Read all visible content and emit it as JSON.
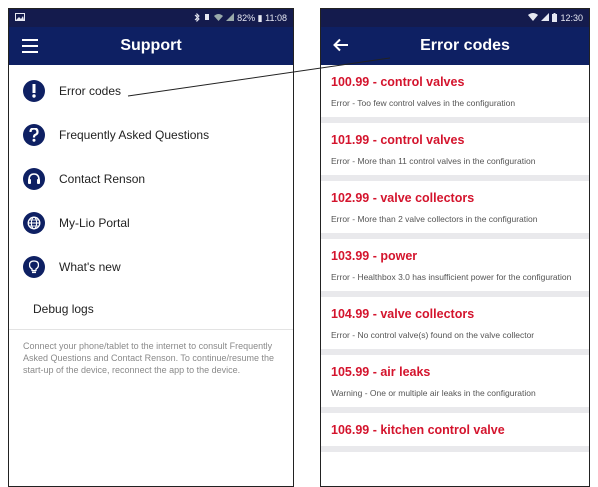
{
  "left_screen": {
    "status": {
      "left_icon": "image-icon",
      "right_text": "82% ▮ 11:08"
    },
    "appbar": {
      "title": "Support"
    },
    "menu": [
      {
        "label": "Error codes",
        "icon": "exclamation-icon"
      },
      {
        "label": "Frequently Asked Questions",
        "icon": "question-icon"
      },
      {
        "label": "Contact Renson",
        "icon": "headset-icon"
      },
      {
        "label": "My-Lio Portal",
        "icon": "globe-icon"
      },
      {
        "label": "What's new",
        "icon": "lightbulb-icon"
      }
    ],
    "debug_logs": "Debug logs",
    "info": "Connect your phone/tablet to the internet to consult Frequently Asked Questions and Contact Renson. To continue/resume the start-up of the device, reconnect the app to the device."
  },
  "right_screen": {
    "status": {
      "time": "12:30"
    },
    "appbar": {
      "title": "Error codes"
    },
    "errors": [
      {
        "title": "100.99 - control valves",
        "desc": "Error - Too few control valves in the configuration"
      },
      {
        "title": "101.99 - control valves",
        "desc": "Error - More than 11 control valves in the configuration"
      },
      {
        "title": "102.99 - valve collectors",
        "desc": "Error - More than 2 valve collectors in the configuration"
      },
      {
        "title": "103.99 - power",
        "desc": "Error - Healthbox 3.0 has insufficient power for the configuration"
      },
      {
        "title": "104.99 - valve collectors",
        "desc": "Error - No control valve(s) found on the valve collector"
      },
      {
        "title": "105.99 - air leaks",
        "desc": "Warning - One or multiple air leaks in the configuration"
      },
      {
        "title": "106.99 - kitchen control valve",
        "desc": ""
      }
    ]
  },
  "colors": {
    "navy": "#0e2063",
    "status_bar": "#141b4d",
    "error_red": "#d4142d",
    "divider": "#e9e9ec"
  }
}
